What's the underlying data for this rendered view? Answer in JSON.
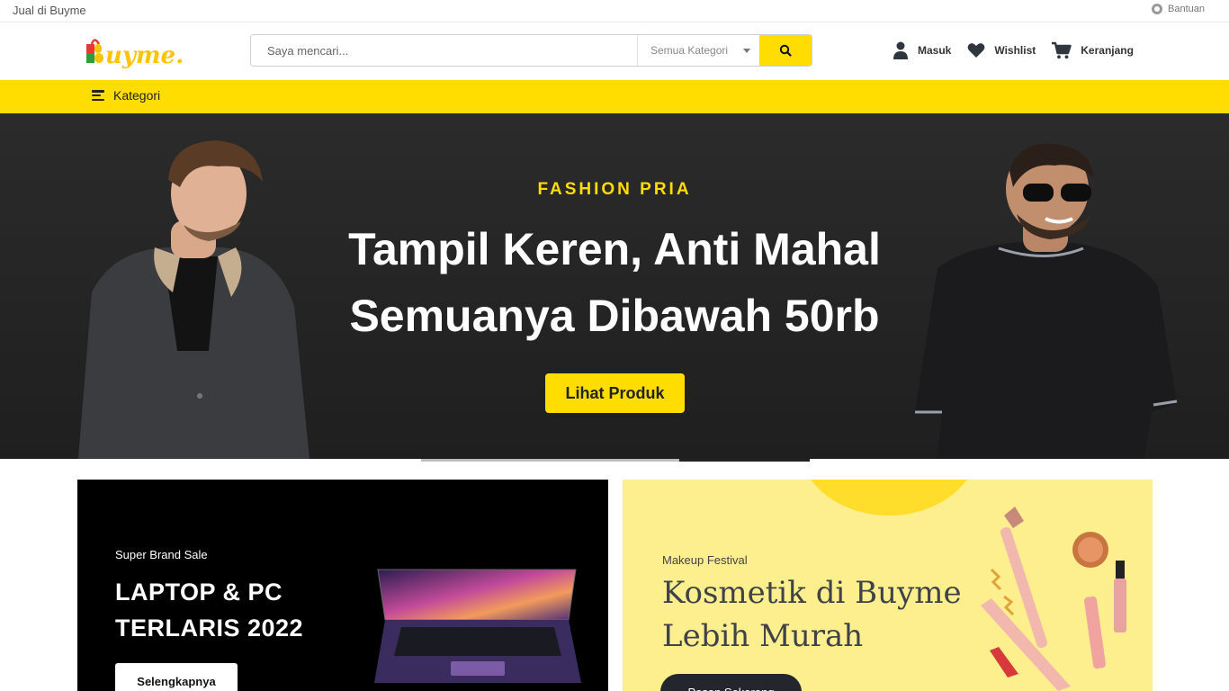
{
  "topbar": {
    "sell_link": "Jual di Buyme",
    "help_label": "Bantuan"
  },
  "header": {
    "logo_text": "Buyme.",
    "search": {
      "placeholder": "Saya mencari...",
      "category": "Semua Kategori"
    },
    "actions": {
      "login": "Masuk",
      "wishlist": "Wishlist",
      "cart": "Keranjang"
    }
  },
  "catbar": {
    "label": "Kategori"
  },
  "hero": {
    "eyebrow": "FASHION PRIA",
    "line1": "Tampil Keren, Anti Mahal",
    "line2": "Semuanya Dibawah 50rb",
    "cta": "Lihat Produk"
  },
  "promos": [
    {
      "small": "Super Brand Sale",
      "line1": "LAPTOP & PC",
      "line2": "TERLARIS 2022",
      "cta": "Selengkapnya"
    },
    {
      "small": "Makeup Festival",
      "line1": "Kosmetik di Buyme",
      "line2": "Lebih Murah",
      "cta": "Pesan Sekarang"
    }
  ],
  "colors": {
    "accent": "#ffdd00",
    "hero_bg": "#232323",
    "promo_right_bg": "#fdee8e"
  }
}
